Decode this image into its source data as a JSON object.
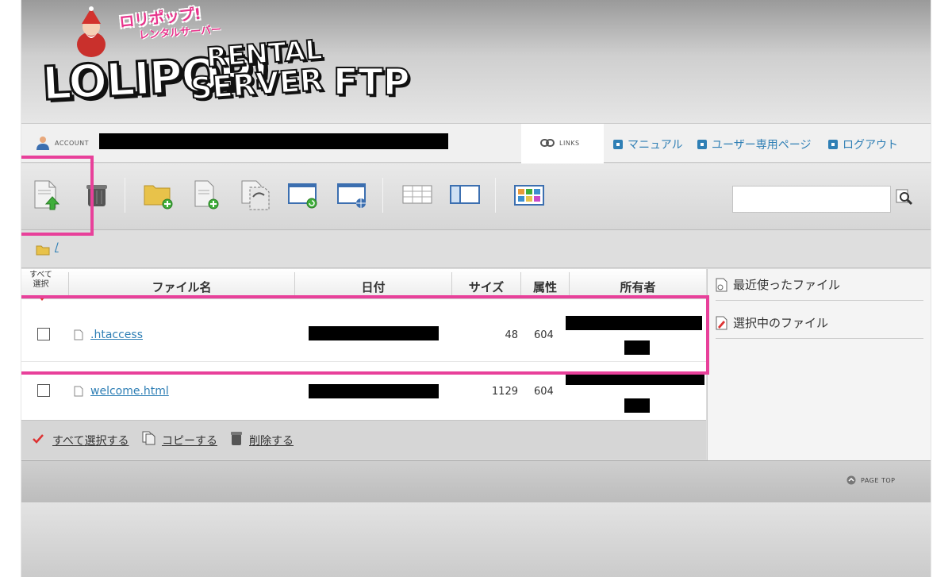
{
  "brand": {
    "jp_line1": "ロリポップ!",
    "jp_line2": "レンタルサーバー",
    "logo_main": "LOLIPOP!",
    "logo_rental": "RENTAL",
    "logo_server": "SERVER",
    "logo_ftp": "FTP"
  },
  "account_bar": {
    "account_label": "ACCOUNT",
    "links_label": "LINKS",
    "nav": [
      "マニュアル",
      "ユーザー専用ページ",
      "ログアウト"
    ]
  },
  "toolbar": {
    "icons": [
      "upload-file-icon",
      "trash-icon",
      "new-folder-icon",
      "new-file-icon",
      "copy-icon",
      "refresh-view-icon",
      "web-view-icon",
      "detail-list-icon",
      "split-view-icon",
      "thumbnail-view-icon"
    ],
    "search_value": ""
  },
  "breadcrumb": {
    "path": "/"
  },
  "table": {
    "select_all_header": [
      "すべて",
      "選択"
    ],
    "columns": [
      "ファイル名",
      "日付",
      "サイズ",
      "属性",
      "所有者"
    ],
    "rows": [
      {
        "name": ".htaccess",
        "size": "48",
        "perm": "604"
      },
      {
        "name": "welcome.html",
        "size": "1129",
        "perm": "604"
      }
    ]
  },
  "actions": {
    "select_all": "すべて選択する",
    "copy": "コピーする",
    "delete": "削除する"
  },
  "side_panel": {
    "recent": "最近使ったファイル",
    "selected": "選択中のファイル"
  },
  "footer": {
    "page_top": "PAGE TOP"
  },
  "colors": {
    "link": "#2f7fb5",
    "highlight": "#e8409a",
    "accent_pink": "#e8348c"
  }
}
